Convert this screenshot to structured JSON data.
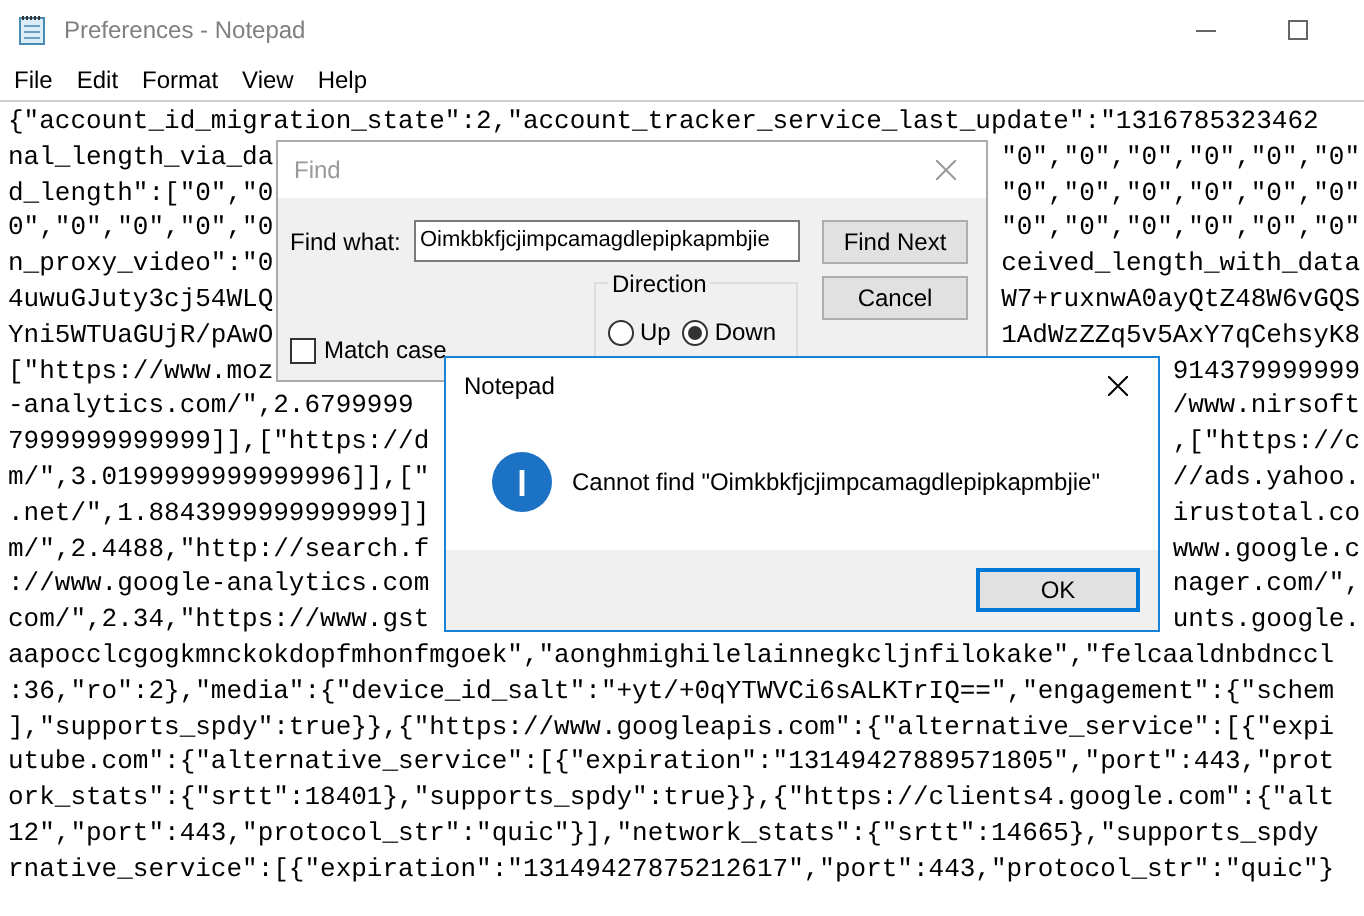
{
  "window": {
    "title": "Preferences - Notepad"
  },
  "menu": [
    "File",
    "Edit",
    "Format",
    "View",
    "Help"
  ],
  "editor": {
    "lines": [
      {
        "start": "{\"account_id_migration_state\":2,\"account_tracker_service_last_update\":\"1316785323462"
      },
      {
        "start": "nal_length_via_da",
        "end": "\"0\",\"0\",\"0\",\"0\",\"0\",\"0\""
      },
      {
        "start": "d_length\":[\"0\",\"0",
        "end": "\"0\",\"0\",\"0\",\"0\",\"0\",\"0\""
      },
      {
        "start": "0\",\"0\",\"0\",\"0\",\"0",
        "end": "\"0\",\"0\",\"0\",\"0\",\"0\",\"0\""
      },
      {
        "start": "n_proxy_video\":\"0",
        "end": "ceived_length_with_data"
      },
      {
        "start": "4uwuGJuty3cj54WLQ",
        "end": "W7+ruxnwA0ayQtZ48W6vGQS"
      },
      {
        "start": "Yni5WTUaGUjR/pAwO",
        "end": "1AdWzZZq5v5AxY7qCehsyK8"
      },
      {
        "start": "[\"https://www.moz",
        "end": "914379999999"
      },
      {
        "start": "-analytics.com/\",2.6799999",
        "end": "/www.nirsoft"
      },
      {
        "start": "7999999999999]],[\"https://d",
        "end": ",[\"https://c"
      },
      {
        "start": "m/\",3.0199999999999996]],[\"",
        "end": "//ads.yahoo."
      },
      {
        "start": ".net/\",1.8843999999999999]]",
        "end": "irustotal.co"
      },
      {
        "start": "m/\",2.4488,\"http://search.f",
        "end": "www.google.c"
      },
      {
        "start": "://www.google-analytics.com",
        "end": "nager.com/\","
      },
      {
        "start": "com/\",2.34,\"https://www.gst",
        "end": "unts.google."
      },
      {
        "start": "aapocclcgogkmnckokdopfmhonfmgoek\",\"aonghmighilelainnegkcljnfilokake\",\"felcaaldnbdnccl"
      },
      {
        "start": ":36,\"ro\":2},\"media\":{\"device_id_salt\":\"+yt/+0qYTWVCi6sALKTrIQ==\",\"engagement\":{\"schem"
      },
      {
        "start": "],\"supports_spdy\":true}},{\"https://www.googleapis.com\":{\"alternative_service\":[{\"expi"
      },
      {
        "start": "utube.com\":{\"alternative_service\":[{\"expiration\":\"13149427889571805\",\"port\":443,\"prot"
      },
      {
        "start": "ork_stats\":{\"srtt\":18401},\"supports_spdy\":true}},{\"https://clients4.google.com\":{\"alt"
      },
      {
        "start": "12\",\"port\":443,\"protocol_str\":\"quic\"}],\"network_stats\":{\"srtt\":14665},\"supports_spdy"
      },
      {
        "start": "rnative_service\":[{\"expiration\":\"13149427875212617\",\"port\":443,\"protocol_str\":\"quic\"}"
      }
    ]
  },
  "find_dialog": {
    "title": "Find",
    "find_what_label": "Find what:",
    "find_what_value": "Oimkbkfjcjimpcamagdlepipkapmbjie",
    "buttons": [
      "Find Next",
      "Cancel"
    ],
    "direction": {
      "label": "Direction",
      "options": [
        {
          "label": "Up",
          "selected": false
        },
        {
          "label": "Down",
          "selected": true
        }
      ]
    },
    "match_case": {
      "label": "Match case",
      "checked": false
    }
  },
  "message_box": {
    "title": "Notepad",
    "message": "Cannot find \"Oimkbkfjcjimpcamagdlepipkapmbjie\"",
    "button": "OK"
  }
}
